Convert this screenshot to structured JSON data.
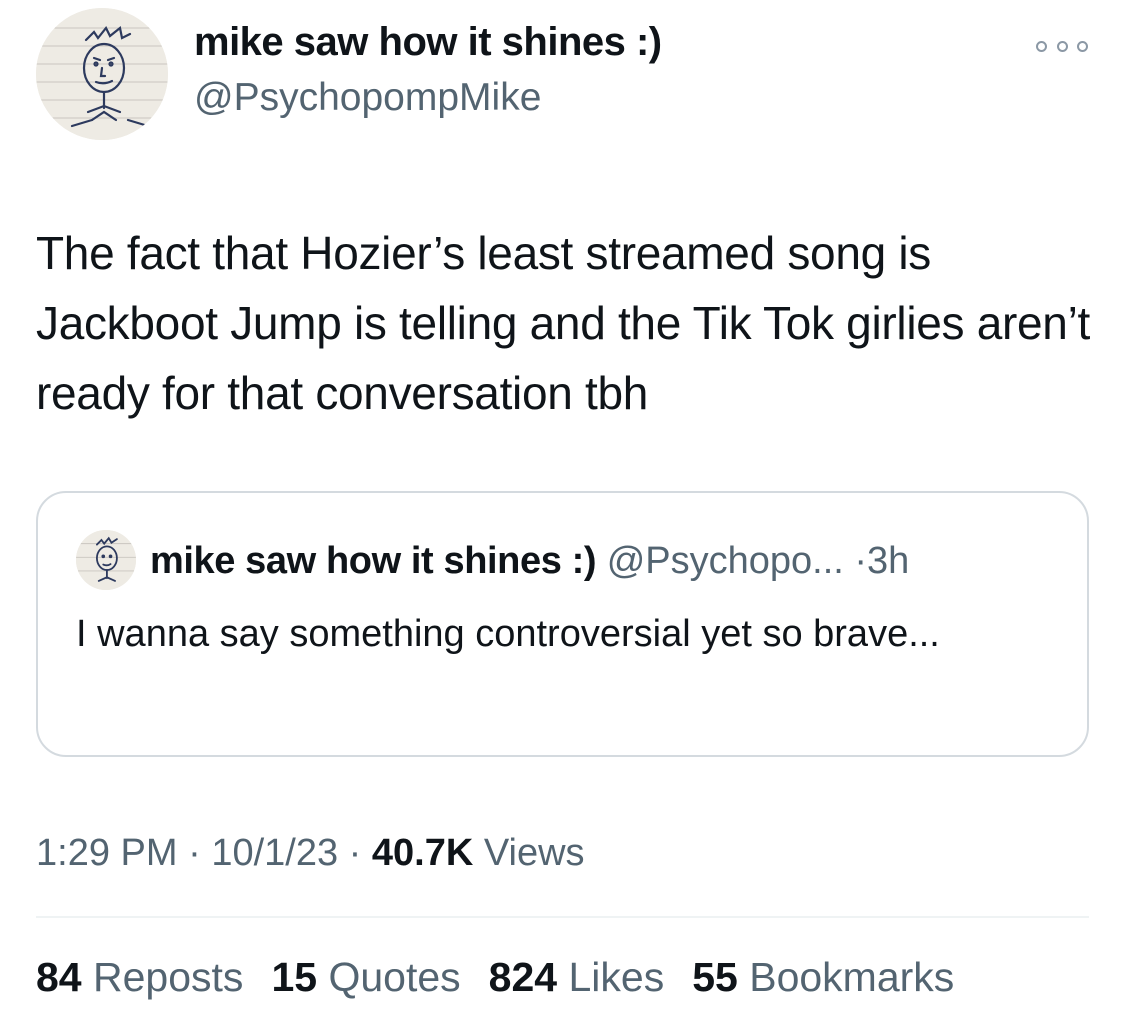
{
  "author": {
    "display_name": "mike saw how it shines :)",
    "handle": "@PsychopompMike",
    "avatar_icon": "sketch-face-avatar"
  },
  "more_icon": "more-horizontal-icon",
  "tweet": {
    "text": "The fact that Hozier’s least streamed song is Jackboot Jump is telling and the Tik Tok girlies aren’t ready for that conversation tbh"
  },
  "quoted_tweet": {
    "display_name": "mike saw how it shines :)",
    "handle": "@Psychopo...",
    "separator": "·",
    "time": "3h",
    "text": "I wanna say something controversial yet so brave..."
  },
  "meta": {
    "time": "1:29 PM",
    "sep1": "·",
    "date": "10/1/23",
    "sep2": "·",
    "views_count": "40.7K",
    "views_label": "Views"
  },
  "stats": [
    {
      "count": "84",
      "label": "Reposts"
    },
    {
      "count": "15",
      "label": "Quotes"
    },
    {
      "count": "824",
      "label": "Likes"
    },
    {
      "count": "55",
      "label": "Bookmarks"
    }
  ],
  "colors": {
    "text_primary": "#0f1419",
    "text_secondary": "#536471",
    "border": "#d4dadf"
  }
}
